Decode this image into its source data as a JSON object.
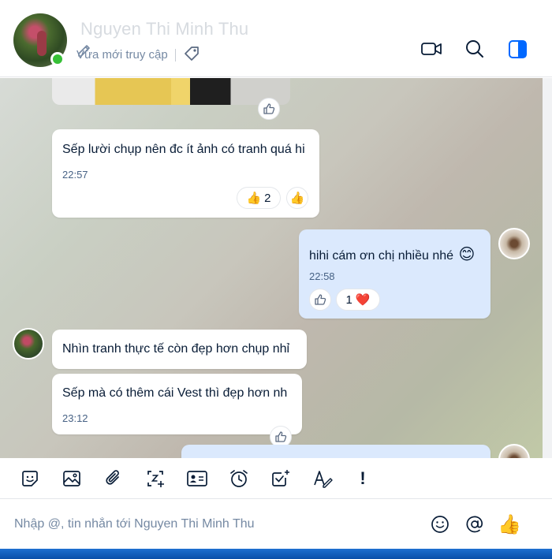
{
  "header": {
    "contact_name": "Nguyen Thi Minh Thu",
    "status": "Vừa mới truy cập",
    "icons": [
      "video-call-icon",
      "search-icon",
      "panel-toggle-icon",
      "tag-icon",
      "edit-name-icon"
    ],
    "accent_color": "#0068ff"
  },
  "messages": [
    {
      "sender": "contact",
      "type": "image",
      "reaction": "like-icon"
    },
    {
      "sender": "contact",
      "text": "Sếp lười chụp nên đc ít ảnh có tranh quá hi",
      "time": "22:57",
      "reaction_emoji": "👍",
      "reaction_count": "2",
      "quick_react": "👍"
    },
    {
      "sender": "me",
      "text": "hihi cám ơn chị nhiều nhé",
      "emoji": "😊",
      "time": "22:58",
      "reaction_count": "1",
      "reaction_emoji": "❤️"
    },
    {
      "sender": "contact",
      "text": "Nhìn tranh thực tế còn đẹp hơn chụp nhỉ"
    },
    {
      "sender": "contact",
      "text": "Sếp mà có thêm cái Vest thì đẹp hơn nh",
      "time": "23:12"
    },
    {
      "sender": "me",
      "text": ""
    }
  ],
  "toolbar": {
    "tools": [
      "sticker-icon",
      "image-icon",
      "attachment-icon",
      "screenshot-icon",
      "contact-card-icon",
      "reminder-icon",
      "task-icon",
      "text-format-icon",
      "urgent-icon"
    ],
    "urgent_label": "!"
  },
  "composer": {
    "placeholder": "Nhập @, tin nhắn tới Nguyen Thi Minh Thu",
    "value": "",
    "emoji_icon": "emoji-icon",
    "mention_icon": "mention-icon",
    "quick_like": "👍"
  }
}
